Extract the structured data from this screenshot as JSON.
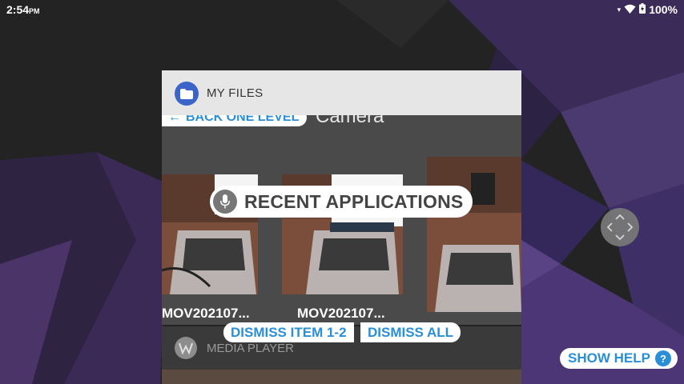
{
  "status_bar": {
    "time": "2:54",
    "ampm": "PM",
    "battery": "100%"
  },
  "recent_card": {
    "app_name": "MY FILES",
    "back_label": "BACK ONE LEVEL",
    "folder_name": "Camera",
    "thumbnails": [
      {
        "label": "MOV202107..."
      },
      {
        "label": "MOV202107..."
      }
    ]
  },
  "overlay": {
    "recent_label": "RECENT APPLICATIONS",
    "dismiss_item_label": "DISMISS ITEM 1-2",
    "dismiss_all_label": "DISMISS ALL",
    "show_help_label": "SHOW HELP",
    "help_glyph": "?"
  },
  "second_card": {
    "app_name": "MEDIA PLAYER"
  },
  "icons": {
    "files": "folder-icon",
    "mic": "microphone-icon",
    "media": "media-player-icon",
    "wifi": "wifi-icon",
    "battery": "battery-icon",
    "nav": "directional-pad-icon"
  },
  "colors": {
    "accent": "#2a8fd6",
    "files_icon": "#3b64c8"
  }
}
